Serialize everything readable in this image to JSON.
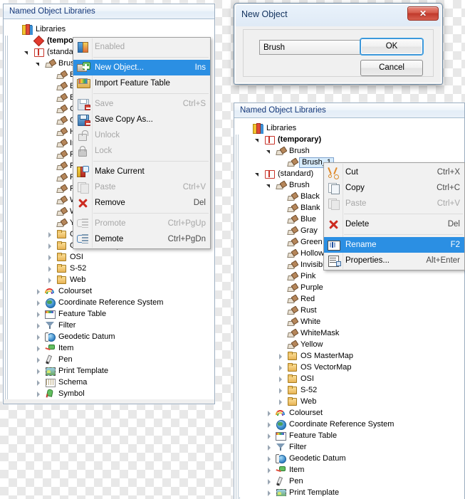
{
  "left_panel": {
    "title": "Named Object Libraries",
    "tree": [
      {
        "label": "Libraries",
        "icon": "libraries-icon",
        "indent": 0,
        "expander": "none",
        "bold": false
      },
      {
        "label": "(temporary)",
        "icon": "library-temporary-icon",
        "indent": 1,
        "expander": "none",
        "bold": true
      },
      {
        "label": "(standard)",
        "icon": "library-standard-icon",
        "indent": 1,
        "expander": "expanded",
        "bold": false
      },
      {
        "label": "Brush",
        "icon": "brush-icon",
        "indent": 2,
        "expander": "expanded",
        "bold": false
      },
      {
        "label": "Black",
        "icon": "brush-icon",
        "indent": 3,
        "expander": "none",
        "bold": false
      },
      {
        "label": "Blank",
        "icon": "brush-icon",
        "indent": 3,
        "expander": "none",
        "bold": false
      },
      {
        "label": "Blue",
        "icon": "brush-icon",
        "indent": 3,
        "expander": "none",
        "bold": false
      },
      {
        "label": "Gray",
        "icon": "brush-icon",
        "indent": 3,
        "expander": "none",
        "bold": false
      },
      {
        "label": "Green",
        "icon": "brush-icon",
        "indent": 3,
        "expander": "none",
        "bold": false
      },
      {
        "label": "Hollow",
        "icon": "brush-icon",
        "indent": 3,
        "expander": "none",
        "bold": false
      },
      {
        "label": "Invisible",
        "icon": "brush-icon",
        "indent": 3,
        "expander": "none",
        "bold": false
      },
      {
        "label": "Pink",
        "icon": "brush-icon",
        "indent": 3,
        "expander": "none",
        "bold": false
      },
      {
        "label": "Purple",
        "icon": "brush-icon",
        "indent": 3,
        "expander": "none",
        "bold": false
      },
      {
        "label": "Red",
        "icon": "brush-icon",
        "indent": 3,
        "expander": "none",
        "bold": false
      },
      {
        "label": "Rust",
        "icon": "brush-icon",
        "indent": 3,
        "expander": "none",
        "bold": false
      },
      {
        "label": "White",
        "icon": "brush-icon",
        "indent": 3,
        "expander": "none",
        "bold": false
      },
      {
        "label": "WhiteMask",
        "icon": "brush-icon",
        "indent": 3,
        "expander": "none",
        "bold": false
      },
      {
        "label": "Yellow",
        "icon": "brush-icon",
        "indent": 3,
        "expander": "none",
        "bold": false
      },
      {
        "label": "OS MasterMap",
        "icon": "folder-icon",
        "indent": 3,
        "expander": "collapsed",
        "bold": false
      },
      {
        "label": "OS VectorMap",
        "icon": "folder-icon",
        "indent": 3,
        "expander": "collapsed",
        "bold": false
      },
      {
        "label": "OSI",
        "icon": "folder-icon",
        "indent": 3,
        "expander": "collapsed",
        "bold": false
      },
      {
        "label": "S-52",
        "icon": "folder-icon",
        "indent": 3,
        "expander": "collapsed",
        "bold": false
      },
      {
        "label": "Web",
        "icon": "folder-icon",
        "indent": 3,
        "expander": "collapsed",
        "bold": false
      },
      {
        "label": "Colourset",
        "icon": "colourset-icon",
        "indent": 2,
        "expander": "collapsed",
        "bold": false
      },
      {
        "label": "Coordinate Reference System",
        "icon": "globe-icon",
        "indent": 2,
        "expander": "collapsed",
        "bold": false
      },
      {
        "label": "Feature Table",
        "icon": "feature-table-icon",
        "indent": 2,
        "expander": "collapsed",
        "bold": false
      },
      {
        "label": "Filter",
        "icon": "filter-icon",
        "indent": 2,
        "expander": "collapsed",
        "bold": false
      },
      {
        "label": "Geodetic Datum",
        "icon": "geodetic-datum-icon",
        "indent": 2,
        "expander": "collapsed",
        "bold": false
      },
      {
        "label": "Item",
        "icon": "item-icon",
        "indent": 2,
        "expander": "collapsed",
        "bold": false
      },
      {
        "label": "Pen",
        "icon": "pen-icon",
        "indent": 2,
        "expander": "collapsed",
        "bold": false
      },
      {
        "label": "Print Template",
        "icon": "print-template-icon",
        "indent": 2,
        "expander": "collapsed",
        "bold": false
      },
      {
        "label": "Schema",
        "icon": "schema-icon",
        "indent": 2,
        "expander": "collapsed",
        "bold": false
      },
      {
        "label": "Symbol",
        "icon": "symbol-icon",
        "indent": 2,
        "expander": "collapsed",
        "bold": false
      }
    ]
  },
  "library_context_menu": {
    "items": [
      {
        "type": "item",
        "label": "Enabled",
        "accel": "",
        "icon": "enabled-icon",
        "state": "disabled"
      },
      {
        "type": "separator"
      },
      {
        "type": "item",
        "label": "New Object...",
        "accel": "Ins",
        "icon": "new-object-icon",
        "state": "highlighted"
      },
      {
        "type": "item",
        "label": "Import Feature Table",
        "accel": "",
        "icon": "import-feature-table-icon",
        "state": "normal"
      },
      {
        "type": "separator"
      },
      {
        "type": "item",
        "label": "Save",
        "accel": "Ctrl+S",
        "icon": "save-icon",
        "state": "disabled"
      },
      {
        "type": "item",
        "label": "Save Copy As...",
        "accel": "",
        "icon": "save-copy-as-icon",
        "state": "normal"
      },
      {
        "type": "item",
        "label": "Unlock",
        "accel": "",
        "icon": "unlock-icon",
        "state": "disabled"
      },
      {
        "type": "item",
        "label": "Lock",
        "accel": "",
        "icon": "lock-icon",
        "state": "disabled"
      },
      {
        "type": "separator"
      },
      {
        "type": "item",
        "label": "Make Current",
        "accel": "",
        "icon": "make-current-icon",
        "state": "normal"
      },
      {
        "type": "item",
        "label": "Paste",
        "accel": "Ctrl+V",
        "icon": "paste-icon",
        "state": "disabled"
      },
      {
        "type": "item",
        "label": "Remove",
        "accel": "Del",
        "icon": "remove-icon",
        "state": "normal"
      },
      {
        "type": "separator"
      },
      {
        "type": "item",
        "label": "Promote",
        "accel": "Ctrl+PgUp",
        "icon": "promote-icon",
        "state": "disabled"
      },
      {
        "type": "item",
        "label": "Demote",
        "accel": "Ctrl+PgDn",
        "icon": "demote-icon",
        "state": "normal"
      }
    ]
  },
  "new_object_dialog": {
    "title": "New Object",
    "close_label": "✕",
    "object_type_value": "Brush",
    "ok_label": "OK",
    "cancel_label": "Cancel"
  },
  "right_panel": {
    "title": "Named Object Libraries",
    "tree": [
      {
        "label": "Libraries",
        "icon": "libraries-icon",
        "indent": 0,
        "expander": "none",
        "bold": false,
        "selected": false
      },
      {
        "label": "(temporary)",
        "icon": "library-standard-icon",
        "indent": 1,
        "expander": "expanded",
        "bold": true,
        "selected": false
      },
      {
        "label": "Brush",
        "icon": "brush-icon",
        "indent": 2,
        "expander": "expanded",
        "bold": false,
        "selected": false
      },
      {
        "label": "Brush_1",
        "icon": "brush-icon",
        "indent": 3,
        "expander": "none",
        "bold": false,
        "selected": true
      },
      {
        "label": "(standard)",
        "icon": "library-standard-icon",
        "indent": 1,
        "expander": "expanded",
        "bold": false,
        "selected": false
      },
      {
        "label": "Brush",
        "icon": "brush-icon",
        "indent": 2,
        "expander": "expanded",
        "bold": false,
        "selected": false
      },
      {
        "label": "Black",
        "icon": "brush-icon",
        "indent": 3,
        "expander": "none",
        "bold": false,
        "selected": false
      },
      {
        "label": "Blank",
        "icon": "brush-icon",
        "indent": 3,
        "expander": "none",
        "bold": false,
        "selected": false
      },
      {
        "label": "Blue",
        "icon": "brush-icon",
        "indent": 3,
        "expander": "none",
        "bold": false,
        "selected": false
      },
      {
        "label": "Gray",
        "icon": "brush-icon",
        "indent": 3,
        "expander": "none",
        "bold": false,
        "selected": false
      },
      {
        "label": "Green",
        "icon": "brush-icon",
        "indent": 3,
        "expander": "none",
        "bold": false,
        "selected": false
      },
      {
        "label": "Hollow",
        "icon": "brush-icon",
        "indent": 3,
        "expander": "none",
        "bold": false,
        "selected": false
      },
      {
        "label": "Invisible",
        "icon": "brush-icon",
        "indent": 3,
        "expander": "none",
        "bold": false,
        "selected": false
      },
      {
        "label": "Pink",
        "icon": "brush-icon",
        "indent": 3,
        "expander": "none",
        "bold": false,
        "selected": false
      },
      {
        "label": "Purple",
        "icon": "brush-icon",
        "indent": 3,
        "expander": "none",
        "bold": false,
        "selected": false
      },
      {
        "label": "Red",
        "icon": "brush-icon",
        "indent": 3,
        "expander": "none",
        "bold": false,
        "selected": false
      },
      {
        "label": "Rust",
        "icon": "brush-icon",
        "indent": 3,
        "expander": "none",
        "bold": false,
        "selected": false
      },
      {
        "label": "White",
        "icon": "brush-icon",
        "indent": 3,
        "expander": "none",
        "bold": false,
        "selected": false
      },
      {
        "label": "WhiteMask",
        "icon": "brush-icon",
        "indent": 3,
        "expander": "none",
        "bold": false,
        "selected": false
      },
      {
        "label": "Yellow",
        "icon": "brush-icon",
        "indent": 3,
        "expander": "none",
        "bold": false,
        "selected": false
      },
      {
        "label": "OS MasterMap",
        "icon": "folder-icon",
        "indent": 3,
        "expander": "collapsed",
        "bold": false,
        "selected": false
      },
      {
        "label": "OS VectorMap",
        "icon": "folder-icon",
        "indent": 3,
        "expander": "collapsed",
        "bold": false,
        "selected": false
      },
      {
        "label": "OSI",
        "icon": "folder-icon",
        "indent": 3,
        "expander": "collapsed",
        "bold": false,
        "selected": false
      },
      {
        "label": "S-52",
        "icon": "folder-icon",
        "indent": 3,
        "expander": "collapsed",
        "bold": false,
        "selected": false
      },
      {
        "label": "Web",
        "icon": "folder-icon",
        "indent": 3,
        "expander": "collapsed",
        "bold": false,
        "selected": false
      },
      {
        "label": "Colourset",
        "icon": "colourset-icon",
        "indent": 2,
        "expander": "collapsed",
        "bold": false,
        "selected": false
      },
      {
        "label": "Coordinate Reference System",
        "icon": "globe-icon",
        "indent": 2,
        "expander": "collapsed",
        "bold": false,
        "selected": false
      },
      {
        "label": "Feature Table",
        "icon": "feature-table-icon",
        "indent": 2,
        "expander": "collapsed",
        "bold": false,
        "selected": false
      },
      {
        "label": "Filter",
        "icon": "filter-icon",
        "indent": 2,
        "expander": "collapsed",
        "bold": false,
        "selected": false
      },
      {
        "label": "Geodetic Datum",
        "icon": "geodetic-datum-icon",
        "indent": 2,
        "expander": "collapsed",
        "bold": false,
        "selected": false
      },
      {
        "label": "Item",
        "icon": "item-icon",
        "indent": 2,
        "expander": "collapsed",
        "bold": false,
        "selected": false
      },
      {
        "label": "Pen",
        "icon": "pen-icon",
        "indent": 2,
        "expander": "collapsed",
        "bold": false,
        "selected": false
      },
      {
        "label": "Print Template",
        "icon": "print-template-icon",
        "indent": 2,
        "expander": "collapsed",
        "bold": false,
        "selected": false
      }
    ]
  },
  "object_context_menu": {
    "items": [
      {
        "type": "item",
        "label": "Cut",
        "accel": "Ctrl+X",
        "icon": "cut-icon",
        "state": "normal"
      },
      {
        "type": "item",
        "label": "Copy",
        "accel": "Ctrl+C",
        "icon": "copy-icon",
        "state": "normal"
      },
      {
        "type": "item",
        "label": "Paste",
        "accel": "Ctrl+V",
        "icon": "paste-icon",
        "state": "disabled"
      },
      {
        "type": "separator"
      },
      {
        "type": "item",
        "label": "Delete",
        "accel": "Del",
        "icon": "delete-icon",
        "state": "normal"
      },
      {
        "type": "separator"
      },
      {
        "type": "item",
        "label": "Rename",
        "accel": "F2",
        "icon": "rename-icon",
        "state": "highlighted"
      },
      {
        "type": "item",
        "label": "Properties...",
        "accel": "Alt+Enter",
        "icon": "properties-icon",
        "state": "normal"
      }
    ]
  },
  "colors": {
    "menu_highlight": "#2b8fe3",
    "title_text": "#15387a",
    "selection_fill": "#d6ebfb",
    "selection_border": "#7da2ce",
    "close_button": "#c0392b"
  }
}
